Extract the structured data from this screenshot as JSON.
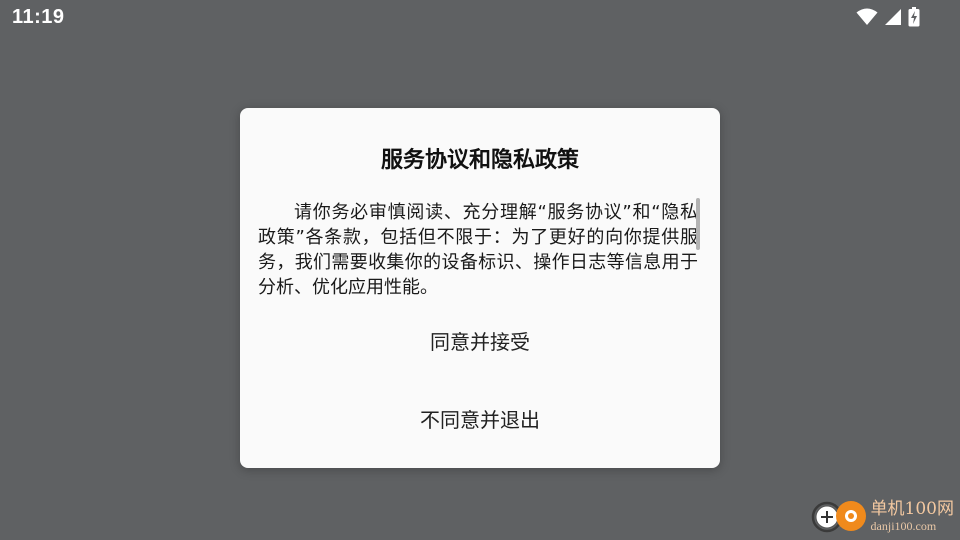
{
  "status_bar": {
    "time": "11:19",
    "icons": [
      "wifi-icon",
      "cellular-signal-icon",
      "battery-charging-icon"
    ]
  },
  "dialog": {
    "title": "服务协议和隐私政策",
    "body": "请你务必审慎阅读、充分理解“服务协议”和“隐私政策”各条款，包括但不限于：为了更好的向你提供服务，我们需要收集你的设备标识、操作日志等信息用于分析、优化应用性能。",
    "accept_label": "同意并接受",
    "decline_label": "不同意并退出"
  },
  "watermark": {
    "title": "单机100网",
    "url": "danji100.com"
  },
  "colors": {
    "background_scrim": "#5f6163",
    "dialog_bg": "#fafafa",
    "watermark_orange": "#f08a1c"
  }
}
